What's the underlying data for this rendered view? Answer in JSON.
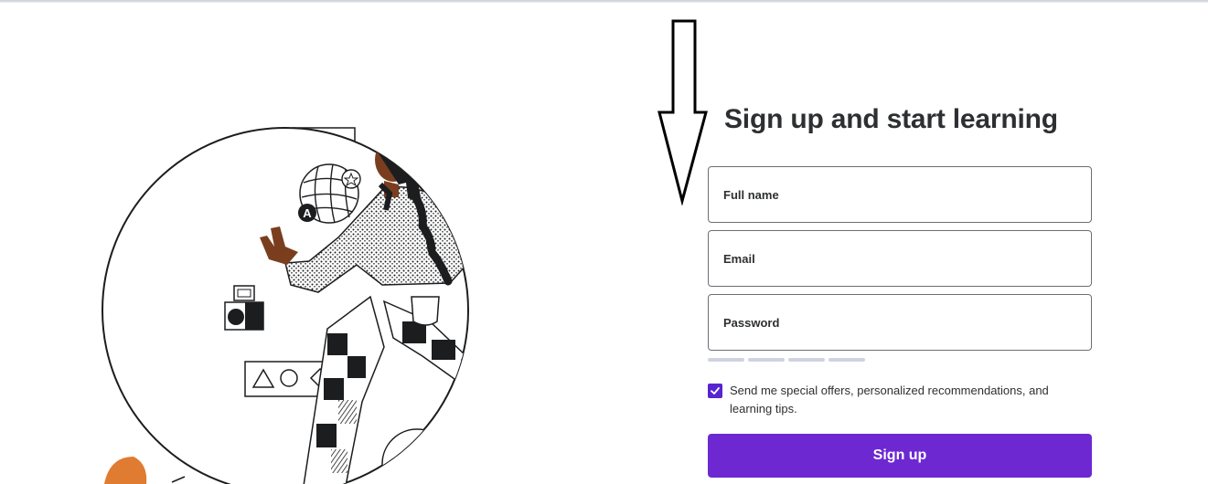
{
  "colors": {
    "accent": "#6d28d2",
    "checkbox": "#5624d0",
    "text": "#2d2f31",
    "field_border": "#6a6f73",
    "strength_empty": "#d1d2e0",
    "skin": "#7a3e1f",
    "orange": "#e07b32"
  },
  "form": {
    "title": "Sign up and start learning",
    "fields": {
      "full_name_placeholder": "Full name",
      "email_placeholder": "Email",
      "password_placeholder": "Password"
    },
    "password_strength_segments": 4,
    "password_strength_filled": 0,
    "consent": {
      "checked": true,
      "label": "Send me special offers, personalized recommendations, and learning tips."
    },
    "submit_label": "Sign up"
  },
  "illustration": {
    "subject": "hero-illustration",
    "icons": [
      "globe-grid-icon",
      "star-icon",
      "letter-a-icon",
      "piano-keys-icon",
      "camera-icon",
      "shapes-box-icon",
      "code-icon",
      "pie-chart-icon"
    ],
    "icon_letter": "A"
  },
  "annotation": {
    "type": "down-arrow"
  }
}
